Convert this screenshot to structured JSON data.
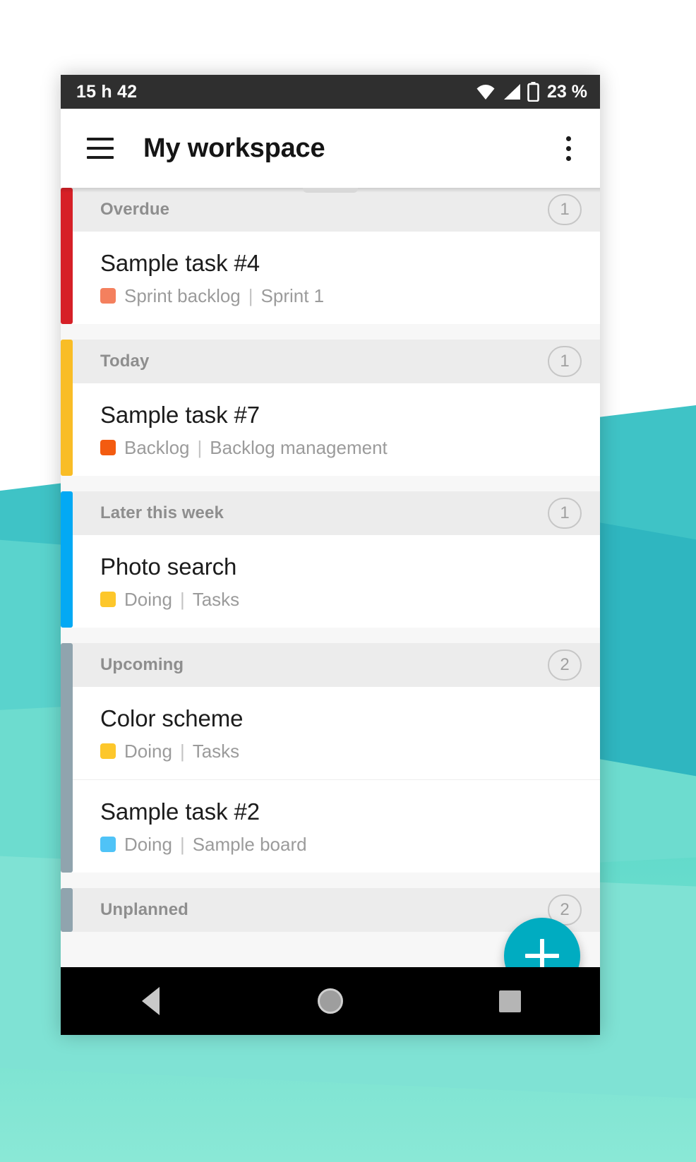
{
  "statusbar": {
    "time": "15 h 42",
    "battery_percent": "23 %",
    "icons": [
      "wifi-icon",
      "cellular-signal-icon",
      "battery-icon"
    ]
  },
  "appbar": {
    "title": "My workspace",
    "menu_icon": "hamburger-menu-icon",
    "overflow_icon": "overflow-menu-icon"
  },
  "fab": {
    "label": "+",
    "icon": "plus-icon",
    "color": "#00acc1"
  },
  "navbar": {
    "back_label": "Back",
    "home_label": "Home",
    "recents_label": "Recents"
  },
  "groups": [
    {
      "title": "Overdue",
      "count": "1",
      "accent": "#d62027",
      "tasks": [
        {
          "title": "Sample task #4",
          "chip_color": "#f4805e",
          "status": "Sprint backlog",
          "separator": "|",
          "board": "Sprint 1"
        }
      ]
    },
    {
      "title": "Today",
      "count": "1",
      "accent": "#f9bd26",
      "tasks": [
        {
          "title": "Sample task #7",
          "chip_color": "#f35b10",
          "status": "Backlog",
          "separator": "|",
          "board": "Backlog management"
        }
      ]
    },
    {
      "title": "Later this week",
      "count": "1",
      "accent": "#03a9f4",
      "tasks": [
        {
          "title": "Photo search",
          "chip_color": "#fdc72b",
          "status": "Doing",
          "separator": "|",
          "board": "Tasks"
        }
      ]
    },
    {
      "title": "Upcoming",
      "count": "2",
      "accent": "#90a4ae",
      "tasks": [
        {
          "title": "Color scheme",
          "chip_color": "#fdc72b",
          "status": "Doing",
          "separator": "|",
          "board": "Tasks"
        },
        {
          "title": "Sample task #2",
          "chip_color": "#4fc3f7",
          "status": "Doing",
          "separator": "|",
          "board": "Sample board"
        }
      ]
    },
    {
      "title": "Unplanned",
      "count": "2",
      "accent": "#90a4ae",
      "tasks": []
    }
  ]
}
